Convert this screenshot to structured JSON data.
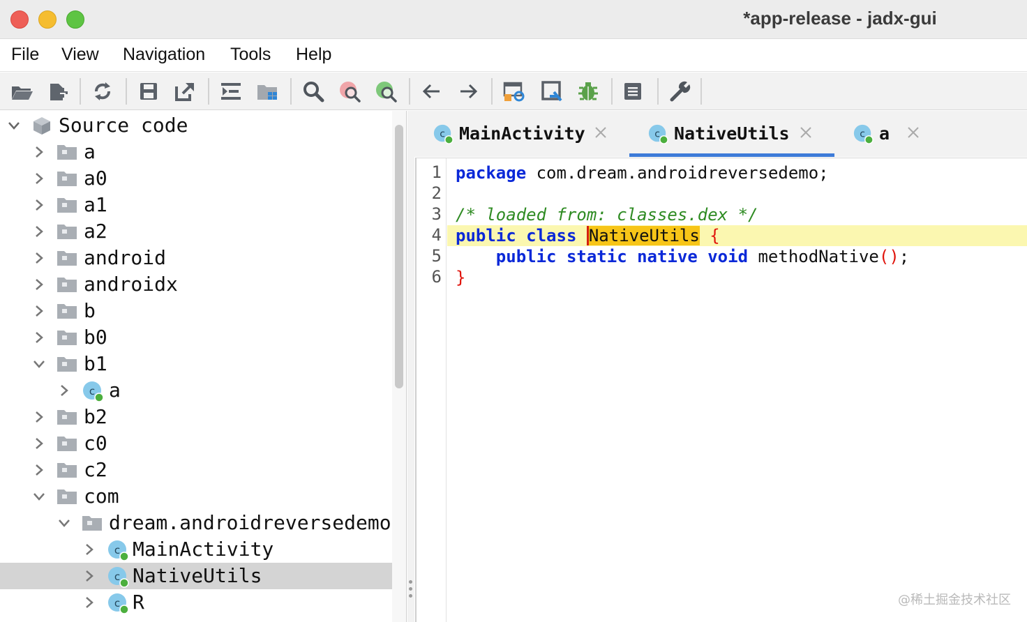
{
  "window": {
    "title": "*app-release - jadx-gui"
  },
  "menu": [
    "File",
    "View",
    "Navigation",
    "Tools",
    "Help"
  ],
  "toolbar": {
    "buttons": [
      "open-file",
      "add-files",
      "reload",
      "save-all",
      "export",
      "sync-code",
      "open-in-explorer",
      "search-text",
      "search-class",
      "search-usage",
      "back",
      "forward",
      "deobfuscation",
      "quark-analysis",
      "debugger",
      "log-viewer",
      "preferences"
    ]
  },
  "tree": {
    "rows": [
      {
        "label": "Source code",
        "type": "root",
        "expanded": true
      },
      {
        "label": "a",
        "type": "package",
        "expanded": false
      },
      {
        "label": "a0",
        "type": "package",
        "expanded": false
      },
      {
        "label": "a1",
        "type": "package",
        "expanded": false
      },
      {
        "label": "a2",
        "type": "package",
        "expanded": false
      },
      {
        "label": "android",
        "type": "package",
        "expanded": false
      },
      {
        "label": "androidx",
        "type": "package",
        "expanded": false
      },
      {
        "label": "b",
        "type": "package",
        "expanded": false
      },
      {
        "label": "b0",
        "type": "package",
        "expanded": false
      },
      {
        "label": "b1",
        "type": "package",
        "expanded": true
      },
      {
        "label": "a",
        "type": "class",
        "expanded": false
      },
      {
        "label": "b2",
        "type": "package",
        "expanded": false
      },
      {
        "label": "c0",
        "type": "package",
        "expanded": false
      },
      {
        "label": "c2",
        "type": "package",
        "expanded": false
      },
      {
        "label": "com",
        "type": "package",
        "expanded": true
      },
      {
        "label": "dream.androidreversedemo",
        "type": "package",
        "expanded": true
      },
      {
        "label": "MainActivity",
        "type": "class",
        "expanded": false
      },
      {
        "label": "NativeUtils",
        "type": "class",
        "expanded": false,
        "selected": true
      },
      {
        "label": "R",
        "type": "class",
        "expanded": false
      }
    ]
  },
  "tabs": [
    {
      "label": "MainActivity",
      "active": false
    },
    {
      "label": "NativeUtils",
      "active": true
    },
    {
      "label": "a",
      "active": false
    }
  ],
  "editor": {
    "line_numbers": [
      "1",
      "2",
      "3",
      "4",
      "5",
      "6"
    ],
    "lines": {
      "l1_kw": "package",
      "l1_rest": " com.dream.androidreversedemo;",
      "l3_comment": "/* loaded from: classes.dex */",
      "l4_kw": "public class ",
      "l4_name": "NativeUtils",
      "l4_space": " ",
      "l4_brace": "{",
      "l5_indent": "    ",
      "l5_kw": "public static native void",
      "l5_method": " methodNative",
      "l5_parens": "()",
      "l5_end": ";",
      "l6_brace": "}"
    },
    "highlighted_line": 4
  },
  "watermark": "@稀土掘金技术社区",
  "colors": {
    "keyword": "#0a28d8",
    "comment": "#2e8b22",
    "brace": "#e0140c",
    "selection": "#f7c518",
    "line_highlight": "#fbf7b0",
    "active_tab_underline": "#3d7bd8"
  }
}
